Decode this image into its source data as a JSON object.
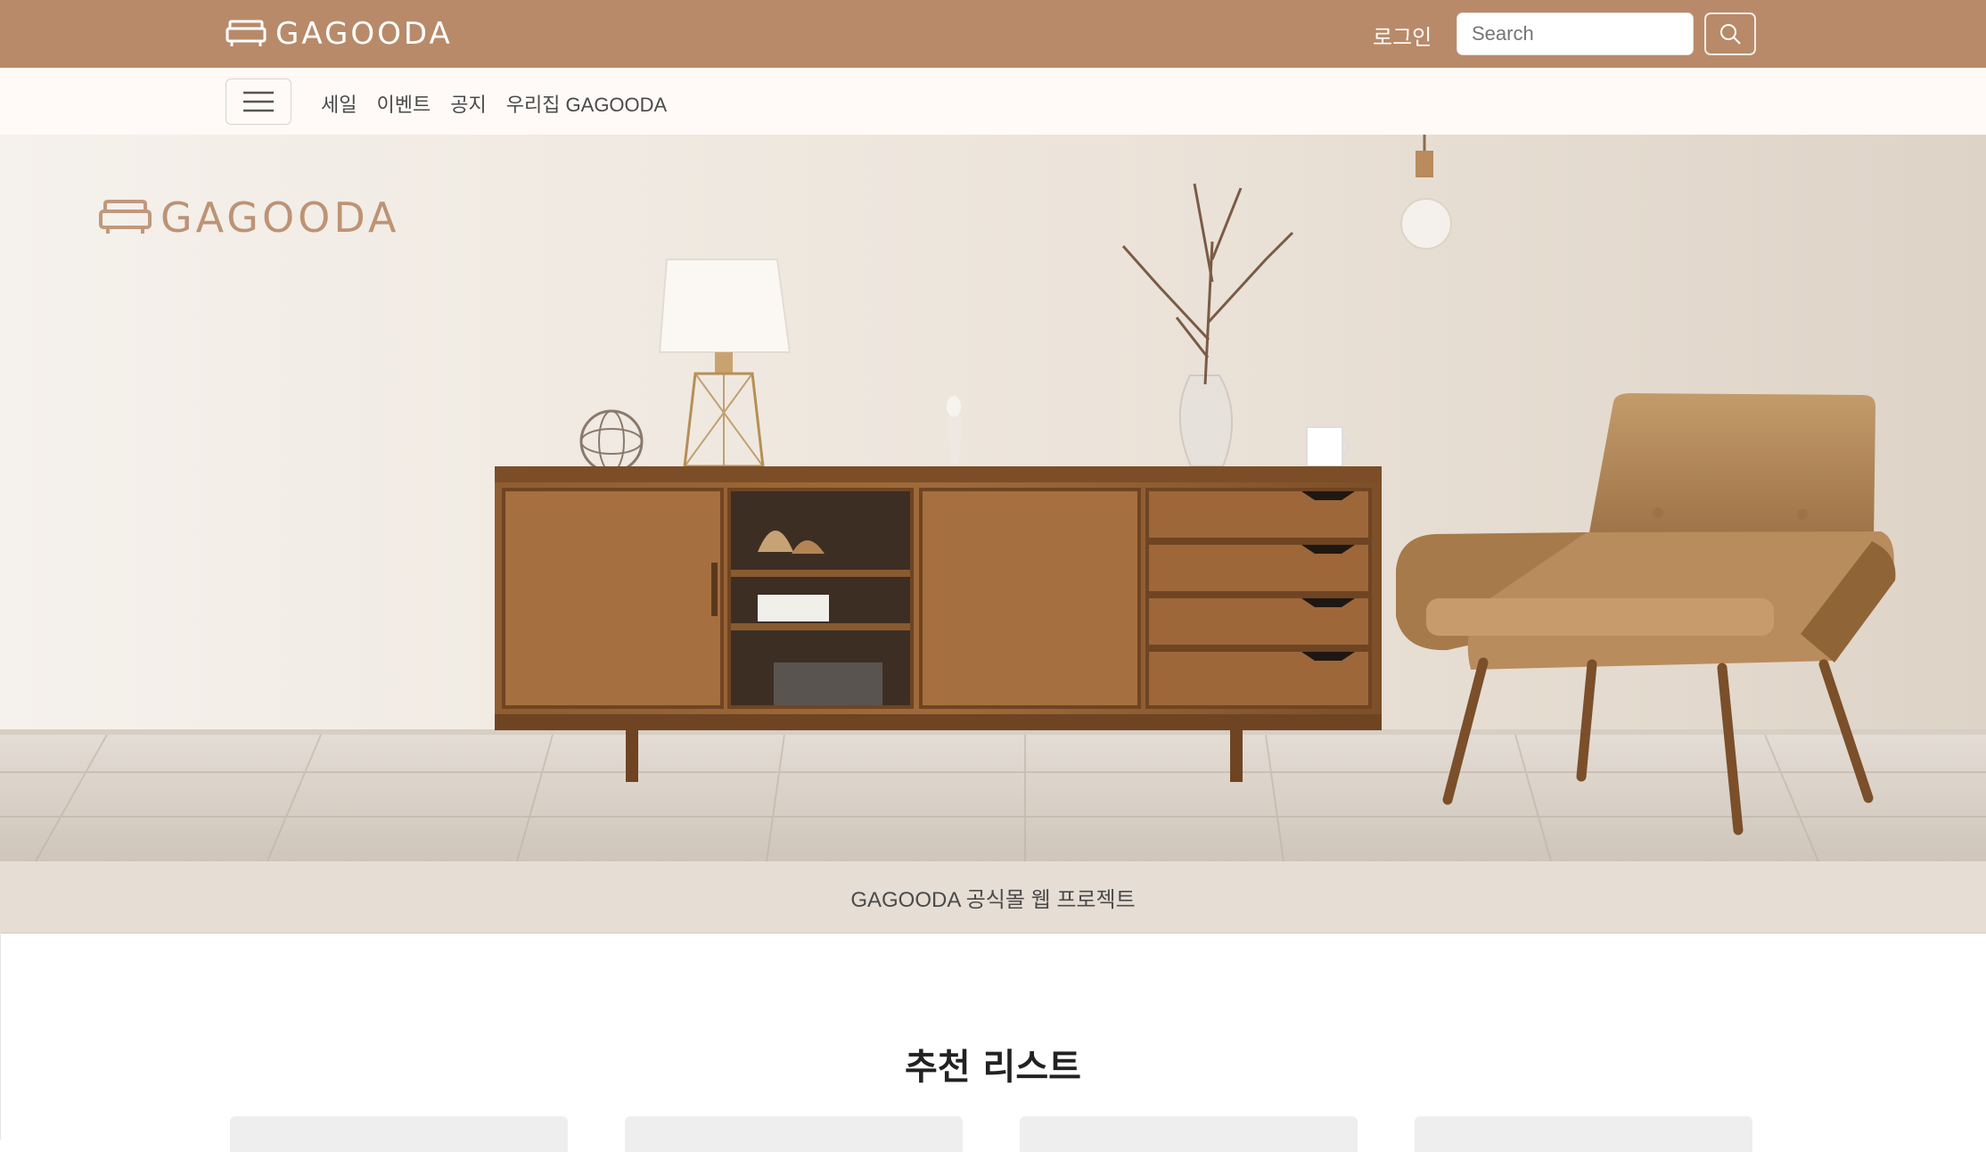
{
  "header": {
    "brand": "GAGOODA",
    "login": "로그인",
    "search_placeholder": "Search"
  },
  "nav": {
    "links": [
      "세일",
      "이벤트",
      "공지",
      "우리집 GAGOODA"
    ]
  },
  "hero": {
    "logo_text": "GAGOODA",
    "caption": "GAGOODA 공식몰 웹 프로젝트"
  },
  "recommendations": {
    "title": "추천 리스트",
    "card_count": 4
  },
  "colors": {
    "header_bg": "#b88a69",
    "nav_bg": "#fffaf7",
    "hero_wall": "#eee7de",
    "caption_bg": "#e6ddd4",
    "wood": "#8b5a2b",
    "chair": "#b5895a"
  }
}
